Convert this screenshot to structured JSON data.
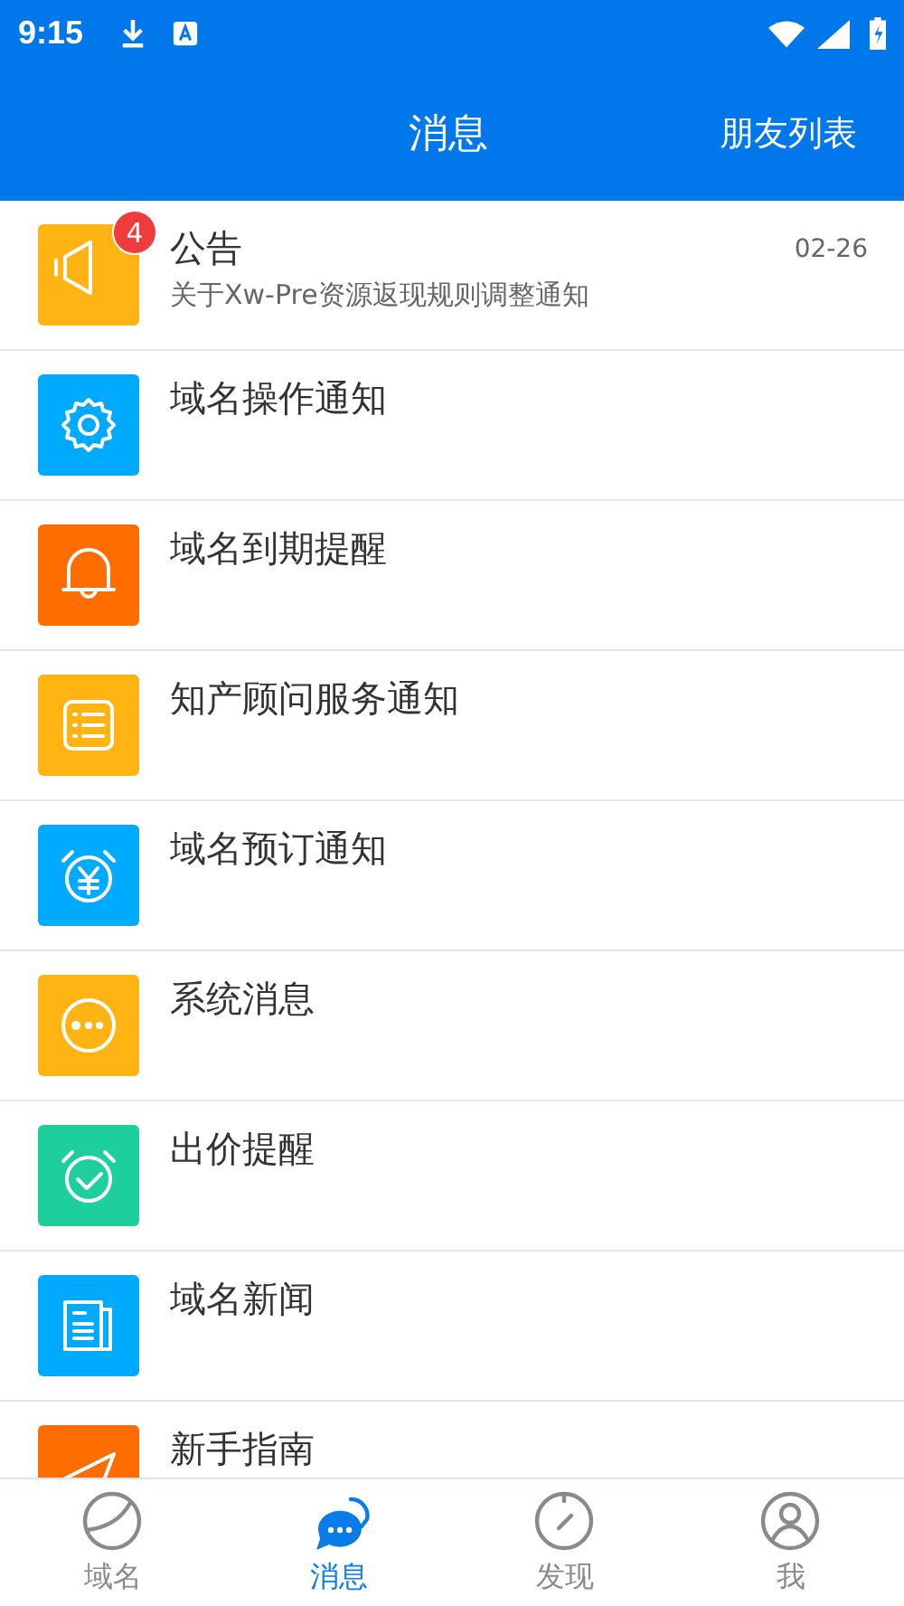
{
  "status_bar": {
    "time": "9:15"
  },
  "header": {
    "title": "消息",
    "action": "朋友列表"
  },
  "messages": [
    {
      "kind": "megaphone",
      "color": "#ffb414",
      "title": "公告",
      "badge": "4",
      "date": "02-26",
      "subtitle": "关于Xw-Pre资源返现规则调整通知"
    },
    {
      "kind": "gear",
      "color": "#00aaff",
      "title": "域名操作通知"
    },
    {
      "kind": "bell",
      "color": "#ff6d00",
      "title": "域名到期提醒"
    },
    {
      "kind": "list",
      "color": "#ffb414",
      "title": "知产顾问服务通知"
    },
    {
      "kind": "yen-alarm",
      "color": "#00aaff",
      "title": "域名预订通知"
    },
    {
      "kind": "dots",
      "color": "#ffb414",
      "title": "系统消息"
    },
    {
      "kind": "check-alarm",
      "color": "#1ccf9d",
      "title": "出价提醒"
    },
    {
      "kind": "news",
      "color": "#00aaff",
      "title": "域名新闻"
    },
    {
      "kind": "send",
      "color": "#ff6d00",
      "title": "新手指南"
    }
  ],
  "tabs": [
    {
      "kind": "domain",
      "label": "域名",
      "selected": false
    },
    {
      "kind": "chat",
      "label": "消息",
      "selected": true
    },
    {
      "kind": "compass",
      "label": "发现",
      "selected": false
    },
    {
      "kind": "person",
      "label": "我",
      "selected": false
    }
  ]
}
